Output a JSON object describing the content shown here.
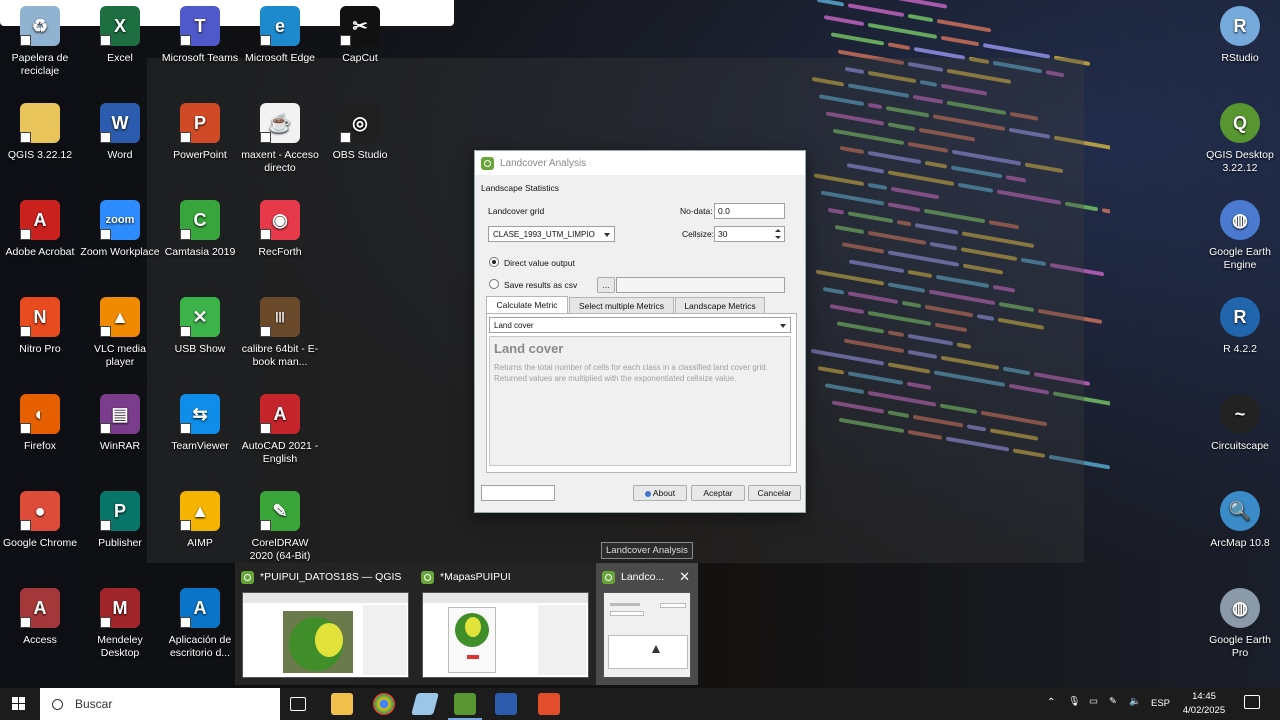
{
  "desktop_icons": [
    {
      "label": "Papelera de reciclaje",
      "icon": "recycle-bin-icon",
      "color": "#8fb3d0",
      "glyph": "♻"
    },
    {
      "label": "Excel",
      "icon": "excel-icon",
      "color": "#1d6f42",
      "glyph": "X"
    },
    {
      "label": "Microsoft Teams",
      "icon": "teams-icon",
      "color": "#5059c9",
      "glyph": "T"
    },
    {
      "label": "Microsoft Edge",
      "icon": "edge-icon",
      "color": "#1c8acd",
      "glyph": "e"
    },
    {
      "label": "CapCut",
      "icon": "capcut-icon",
      "color": "#111111",
      "glyph": "✂"
    },
    {
      "label": "QGIS 3.22.12",
      "icon": "folder-icon",
      "color": "#e8c45a",
      "glyph": ""
    },
    {
      "label": "Word",
      "icon": "word-icon",
      "color": "#2b5cad",
      "glyph": "W"
    },
    {
      "label": "PowerPoint",
      "icon": "powerpoint-icon",
      "color": "#d04a26",
      "glyph": "P"
    },
    {
      "label": "maxent - Acceso directo",
      "icon": "java-icon",
      "color": "#f2f2f2",
      "glyph": "☕"
    },
    {
      "label": "OBS Studio",
      "icon": "obs-icon",
      "color": "#202020",
      "glyph": "◎"
    },
    {
      "label": "Adobe Acrobat",
      "icon": "acrobat-icon",
      "color": "#c9211e",
      "glyph": "A"
    },
    {
      "label": "Zoom Workplace",
      "icon": "zoom-icon",
      "color": "#2d8cff",
      "glyph": "zoom"
    },
    {
      "label": "Camtasia 2019",
      "icon": "camtasia-icon",
      "color": "#37a53c",
      "glyph": "C"
    },
    {
      "label": "RecForth",
      "icon": "recforth-icon",
      "color": "#e6394a",
      "glyph": "◉"
    },
    {
      "label": "Nitro Pro",
      "icon": "nitro-icon",
      "color": "#e84b1f",
      "glyph": "N"
    },
    {
      "label": "VLC media player",
      "icon": "vlc-icon",
      "color": "#f08a00",
      "glyph": "▲"
    },
    {
      "label": "USB Show",
      "icon": "usb-show-icon",
      "color": "#3bb34a",
      "glyph": "✕"
    },
    {
      "label": "calibre 64bit - E-book man...",
      "icon": "calibre-icon",
      "color": "#6b4a2c",
      "glyph": "|||"
    },
    {
      "label": "Firefox",
      "icon": "firefox-icon",
      "color": "#e66000",
      "glyph": "◐"
    },
    {
      "label": "WinRAR",
      "icon": "winrar-icon",
      "color": "#7a3d8c",
      "glyph": "▤"
    },
    {
      "label": "TeamViewer",
      "icon": "teamviewer-icon",
      "color": "#0e8ee9",
      "glyph": "⇆"
    },
    {
      "label": "AutoCAD 2021 - English",
      "icon": "autocad-icon",
      "color": "#c4242a",
      "glyph": "A"
    },
    {
      "label": "Google Chrome",
      "icon": "chrome-icon",
      "color": "#dd4b39",
      "glyph": "●"
    },
    {
      "label": "Publisher",
      "icon": "publisher-icon",
      "color": "#077568",
      "glyph": "P"
    },
    {
      "label": "AIMP",
      "icon": "aimp-icon",
      "color": "#f5b400",
      "glyph": "▲"
    },
    {
      "label": "CorelDRAW 2020 (64-Bit)",
      "icon": "coreldraw-icon",
      "color": "#3aa63a",
      "glyph": "✎"
    },
    {
      "label": "Access",
      "icon": "access-icon",
      "color": "#a4373a",
      "glyph": "A"
    },
    {
      "label": "Mendeley Desktop",
      "icon": "mendeley-icon",
      "color": "#a0252a",
      "glyph": "M"
    },
    {
      "label": "Aplicación de escritorio d...",
      "icon": "azure-icon",
      "color": "#0a74c9",
      "glyph": "A"
    }
  ],
  "right_icons": [
    {
      "label": "RStudio",
      "icon": "rstudio-icon",
      "color": "#75aadb",
      "glyph": "R"
    },
    {
      "label": "QGIS Desktop 3.22.12",
      "icon": "qgis-icon",
      "color": "#589632",
      "glyph": "Q"
    },
    {
      "label": "Google Earth Engine",
      "icon": "earth-engine-icon",
      "color": "#4a7bd1",
      "glyph": "◍"
    },
    {
      "label": "R 4.2.2",
      "icon": "r-icon",
      "color": "#2166ac",
      "glyph": "R"
    },
    {
      "label": "Circuitscape",
      "icon": "circuitscape-icon",
      "color": "#222222",
      "glyph": "~"
    },
    {
      "label": "ArcMap 10.8",
      "icon": "arcmap-icon",
      "color": "#3a8bc7",
      "glyph": "🔍"
    },
    {
      "label": "Google Earth Pro",
      "icon": "earth-pro-icon",
      "color": "#8a9aa8",
      "glyph": "◍"
    }
  ],
  "dialog": {
    "title": "Landcover Analysis",
    "section": "Landscape Statistics",
    "grid_label": "Landcover grid",
    "grid_value": "CLASE_1993_UTM_LIMPIO",
    "nodata_label": "No-data:",
    "nodata_value": "0.0",
    "cellsize_label": "Cellsize:",
    "cellsize_value": "30",
    "radio_direct": "Direct value output",
    "radio_csv": "Save results as csv",
    "browse_label": "...",
    "tabs": [
      "Calculate Metric",
      "Select multiple Metrics",
      "Landscape Metrics"
    ],
    "metric_value": "Land cover",
    "desc_title": "Land cover",
    "desc_text": "Returns the total number of cells for each class in a classified land cover grid. Returned values are multiplied with the exponentiated cellsize value.",
    "about_label": "About",
    "accept_label": "Aceptar",
    "cancel_label": "Cancelar"
  },
  "tooltip": "Landcover Analysis",
  "thumbnails": [
    {
      "title": "*PUIPUI_DATOS18S — QGIS"
    },
    {
      "title": "*MapasPUIPUI"
    },
    {
      "title": "Landco..."
    }
  ],
  "taskbar": {
    "search_placeholder": "Buscar",
    "language": "ESP",
    "time": "14:45",
    "date": "4/02/2025"
  }
}
